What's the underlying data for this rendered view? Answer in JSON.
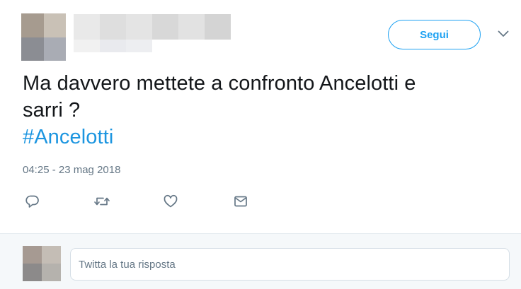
{
  "colors": {
    "accent": "#1da1f2",
    "hashtag": "#1b95e0",
    "text": "#14171a",
    "muted": "#657786",
    "reply_bg": "#f5f8fa"
  },
  "header": {
    "follow_label": "Segui",
    "more_icon": "chevron-down-icon"
  },
  "tweet": {
    "text_line1": "Ma davvero mettete a confronto Ancelotti e",
    "text_line2": "sarri ?",
    "hashtag": "#Ancelotti",
    "timestamp": "04:25 - 23 mag 2018"
  },
  "actions": [
    {
      "name": "reply",
      "icon": "reply-icon"
    },
    {
      "name": "retweet",
      "icon": "retweet-icon"
    },
    {
      "name": "like",
      "icon": "heart-icon"
    },
    {
      "name": "direct-message",
      "icon": "envelope-icon"
    }
  ],
  "reply": {
    "placeholder": "Twitta la tua risposta"
  }
}
